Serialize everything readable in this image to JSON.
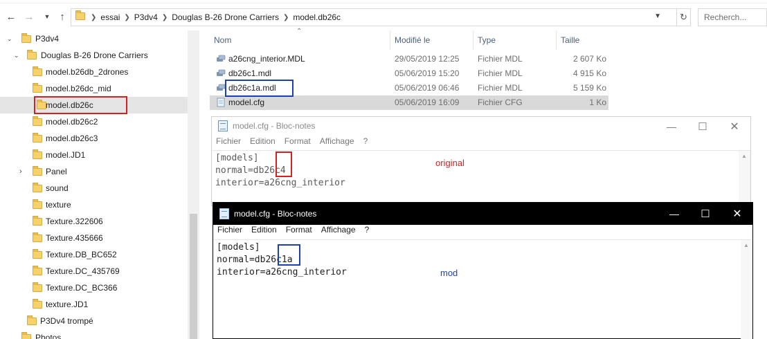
{
  "colors": {
    "red_box": "#d62020",
    "blue_box": "#1c3fb3",
    "selected_bg": "#d9d9d9"
  },
  "address": {
    "back_icon": "arrow-left-icon",
    "crumbs": [
      "essai",
      "P3dv4",
      "Douglas B-26 Drone Carriers",
      "model.db26c"
    ],
    "search_placeholder": "Recherch..."
  },
  "tree": {
    "items": [
      {
        "label": "P3dv4",
        "expanded": true
      },
      {
        "label": "Douglas B-26 Drone Carriers",
        "expanded": true
      },
      {
        "label": "model.b26db_2drones"
      },
      {
        "label": "model.b26dc_mid"
      },
      {
        "label": "model.db26c",
        "selected": true
      },
      {
        "label": "model.db26c2"
      },
      {
        "label": "model.db26c3"
      },
      {
        "label": "model.JD1"
      },
      {
        "label": "Panel",
        "collapsed": true
      },
      {
        "label": "sound"
      },
      {
        "label": "texture"
      },
      {
        "label": "Texture.322606"
      },
      {
        "label": "Texture.435666"
      },
      {
        "label": "Texture.DB_BC652"
      },
      {
        "label": "Texture.DC_435769"
      },
      {
        "label": "Texture.DC_BC366"
      },
      {
        "label": "texture.JD1"
      },
      {
        "label": "P3Dv4 trompé"
      },
      {
        "label": "Photos"
      }
    ]
  },
  "files": {
    "headers": {
      "name": "Nom",
      "date": "Modifié le",
      "type": "Type",
      "size": "Taille"
    },
    "rows": [
      {
        "name": "a26cng_interior.MDL",
        "date": "29/05/2019 12:25",
        "type": "Fichier MDL",
        "size": "2 607 Ko",
        "icon": "mdl-file-icon"
      },
      {
        "name": "db26c1.mdl",
        "date": "05/06/2019 15:20",
        "type": "Fichier MDL",
        "size": "4 915 Ko",
        "icon": "mdl-file-icon"
      },
      {
        "name": "db26c1a.mdl",
        "date": "05/06/2019 06:46",
        "type": "Fichier MDL",
        "size": "5 159 Ko",
        "icon": "mdl-file-icon"
      },
      {
        "name": "model.cfg",
        "date": "05/06/2019 16:09",
        "type": "Fichier CFG",
        "size": "1 Ko",
        "icon": "cfg-file-icon",
        "selected": true
      }
    ]
  },
  "notepad1": {
    "title": "model.cfg - Bloc-notes",
    "menu": [
      "Fichier",
      "Edition",
      "Format",
      "Affichage",
      "?"
    ],
    "lines": [
      "[models]",
      "normal=db26c4",
      "interior=a26cng_interior"
    ],
    "annotation": "original"
  },
  "notepad2": {
    "title": "model.cfg - Bloc-notes",
    "menu": [
      "Fichier",
      "Edition",
      "Format",
      "Affichage",
      "?"
    ],
    "lines": [
      "[models]",
      "normal=db26c1a",
      "interior=a26cng_interior"
    ],
    "annotation": "mod"
  }
}
